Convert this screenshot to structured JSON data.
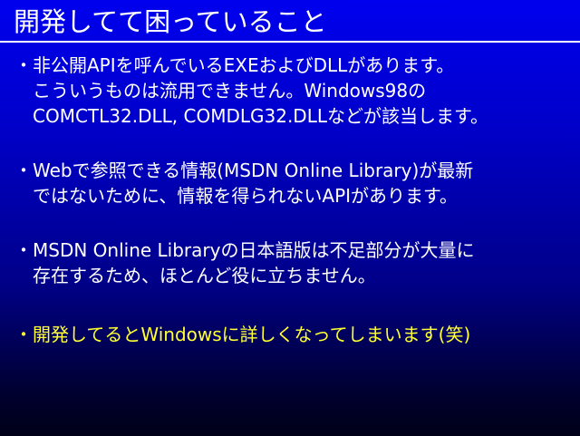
{
  "slide": {
    "title": "開発してて困っていること",
    "bullet_mark": "・",
    "bullets": [
      {
        "lines": [
          "非公開APIを呼んでいるEXEおよびDLLがあります。",
          "こういうものは流用できません。Windows98の",
          "COMCTL32.DLL, COMDLG32.DLLなどが該当します。"
        ]
      },
      {
        "lines": [
          "Webで参照できる情報(MSDN Online Library)が最新",
          "ではないために、情報を得られないAPIがあります。"
        ]
      },
      {
        "lines": [
          "MSDN Online Libraryの日本語版は不足部分が大量に",
          "存在するため、ほとんど役に立ちません。"
        ]
      },
      {
        "lines": [
          "開発してるとWindowsに詳しくなってしまいます(笑)"
        ]
      }
    ]
  },
  "colors": {
    "text": "#ffffff",
    "highlight_text": "#ffff33",
    "background_top": "#0000ee",
    "background_bottom": "#000018"
  }
}
